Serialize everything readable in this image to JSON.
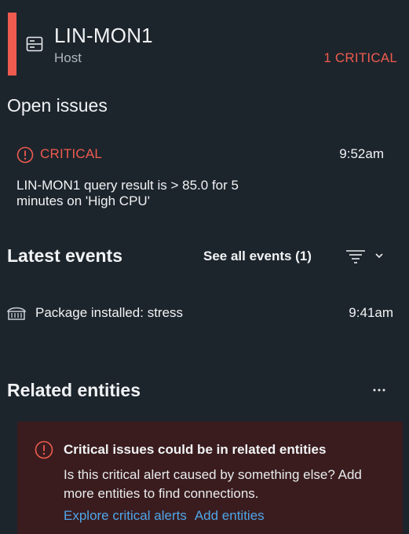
{
  "header": {
    "entity_name": "LIN-MON1",
    "entity_type": "Host",
    "critical_count": "1 CRITICAL",
    "accent_color": "#ef5b4f"
  },
  "open_issues": {
    "title": "Open issues",
    "issue": {
      "status": "CRITICAL",
      "time": "9:52am",
      "description": "LIN-MON1 query result is > 85.0 for 5 minutes on 'High CPU'"
    }
  },
  "latest_events": {
    "title": "Latest events",
    "see_all": "See all events (1)",
    "events": [
      {
        "icon": "package-icon",
        "label": "Package installed: stress",
        "time": "9:41am"
      }
    ]
  },
  "related_entities": {
    "title": "Related entities",
    "alert": {
      "title": "Critical issues could be in related entities",
      "body": "Is this critical alert caused by something else? Add more entities to find connections.",
      "link_explore": "Explore critical alerts",
      "link_add": "Add entities"
    }
  },
  "colors": {
    "background": "#1d252c",
    "critical": "#ef5b4f",
    "link": "#4ea6ea",
    "alert_bg": "#3a1c1e"
  }
}
